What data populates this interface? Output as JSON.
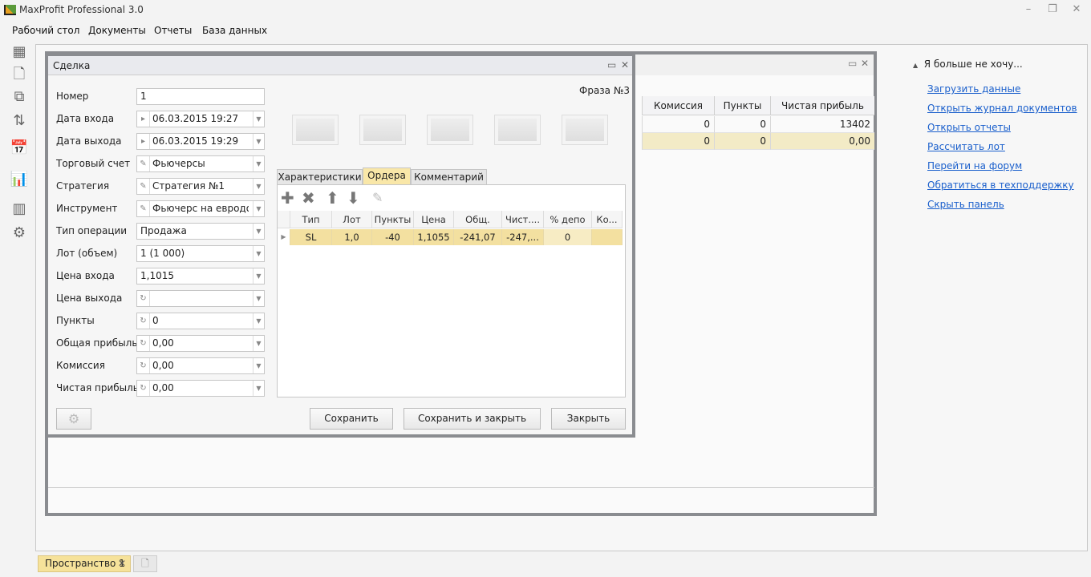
{
  "app": {
    "title": "MaxProfit Professional 3.0"
  },
  "menu": [
    "Рабочий стол",
    "Документы",
    "Отчеты",
    "База данных"
  ],
  "background_grid": {
    "headers": [
      "Комиссия",
      "Пункты",
      "Чистая прибыль"
    ],
    "rows": [
      [
        "0",
        "0",
        "13402"
      ],
      [
        "0",
        "0",
        "0,00"
      ]
    ]
  },
  "dialog": {
    "title": "Сделка",
    "phase": "Фраза №3",
    "fields": [
      {
        "label": "Номер",
        "value": "1",
        "icon": "",
        "dropdown": false
      },
      {
        "label": "Дата входа",
        "value": "06.03.2015 19:27",
        "icon": "▸",
        "dropdown": true
      },
      {
        "label": "Дата выхода",
        "value": "06.03.2015 19:29",
        "icon": "▸",
        "dropdown": true
      },
      {
        "label": "Торговый счет",
        "value": "Фьючерсы",
        "icon": "✎",
        "dropdown": true
      },
      {
        "label": "Стратегия",
        "value": "Стратегия №1",
        "icon": "✎",
        "dropdown": true
      },
      {
        "label": "Инструмент",
        "value": "Фьючерс на евродо...",
        "icon": "✎",
        "dropdown": true
      },
      {
        "label": "Тип операции",
        "value": "Продажа",
        "icon": "",
        "dropdown": true
      },
      {
        "label": "Лот (объем)",
        "value": "1 (1 000)",
        "icon": "",
        "dropdown": true
      },
      {
        "label": "Цена входа",
        "value": "1,1015",
        "icon": "",
        "dropdown": true
      },
      {
        "label": "Цена выхода",
        "value": "",
        "icon": "↻",
        "dropdown": true
      },
      {
        "label": "Пункты",
        "value": "0",
        "icon": "↻",
        "dropdown": true
      },
      {
        "label": "Общая прибыль",
        "value": "0,00",
        "icon": "↻",
        "dropdown": true
      },
      {
        "label": "Комиссия",
        "value": "0,00",
        "icon": "↻",
        "dropdown": true
      },
      {
        "label": "Чистая прибыль",
        "value": "0,00",
        "icon": "↻",
        "dropdown": true
      }
    ],
    "tabs": [
      "Характеристики",
      "Ордера",
      "Комментарий"
    ],
    "active_tab": 1,
    "orders": {
      "headers": [
        "Тип",
        "Лот",
        "Пункты",
        "Цена",
        "Общ. пр...",
        "Чист....",
        "% депо",
        "Ко..."
      ],
      "rows": [
        [
          "SL",
          "1,0",
          "-40",
          "1,1055",
          "-241,07",
          "-247,...",
          "0",
          ""
        ]
      ]
    },
    "buttons": {
      "save": "Сохранить",
      "save_close": "Сохранить и закрыть",
      "close": "Закрыть"
    }
  },
  "panel": {
    "header": "Я больше не хочу...",
    "links": [
      "Загрузить данные",
      "Открыть журнал документов",
      "Открыть отчеты",
      "Рассчитать лот",
      "Перейти на форум",
      "Обратиться в техподдержку",
      "Скрыть панель"
    ]
  },
  "workspace_tab": "Пространство 1"
}
